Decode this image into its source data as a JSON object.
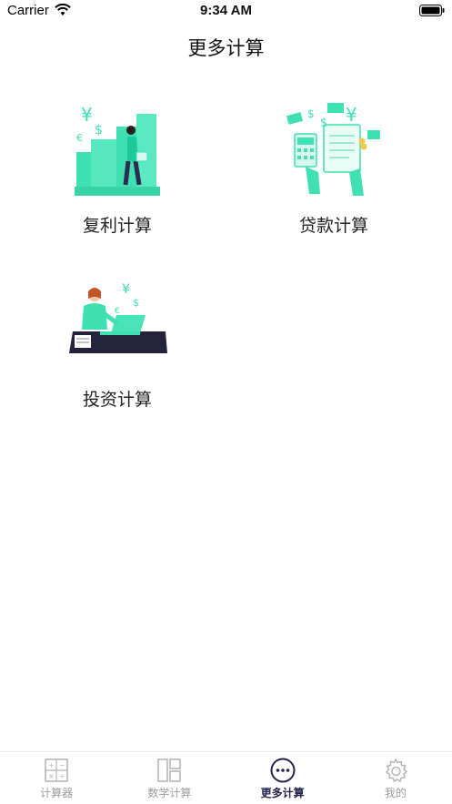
{
  "status_bar": {
    "carrier": "Carrier",
    "time": "9:34 AM"
  },
  "nav": {
    "title": "更多计算"
  },
  "cards": [
    {
      "label": "复利计算",
      "icon": "compound-interest-illustration"
    },
    {
      "label": "贷款计算",
      "icon": "loan-illustration"
    },
    {
      "label": "投资计算",
      "icon": "investment-illustration"
    }
  ],
  "tab_bar": {
    "items": [
      {
        "label": "计算器",
        "icon": "calculator-icon",
        "active": false
      },
      {
        "label": "数学计算",
        "icon": "layout-icon",
        "active": false
      },
      {
        "label": "更多计算",
        "icon": "more-icon",
        "active": true
      },
      {
        "label": "我的",
        "icon": "gear-icon",
        "active": false
      }
    ]
  },
  "colors": {
    "accent": "#40e0b0",
    "active_tab": "#26234d",
    "inactive_tab": "#9a9a9a"
  }
}
